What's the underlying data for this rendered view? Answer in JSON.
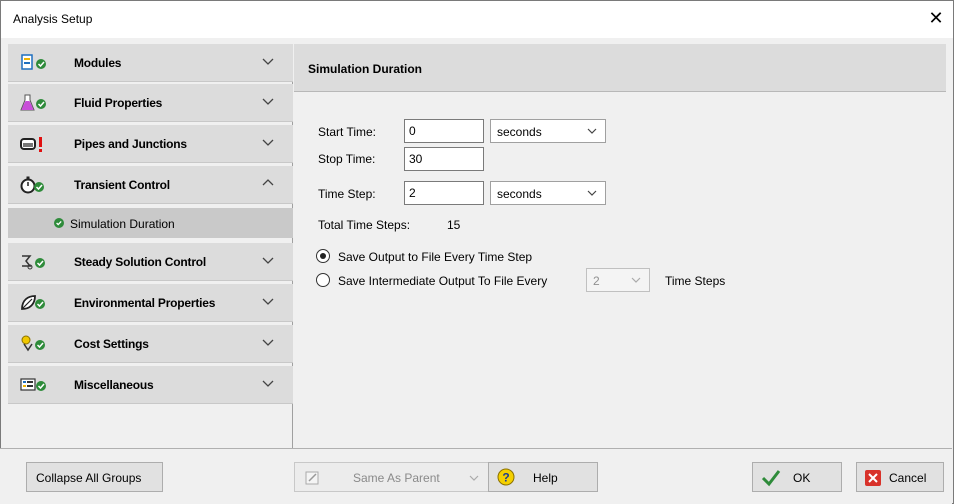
{
  "window": {
    "title": "Analysis Setup",
    "close_glyph": "✕"
  },
  "sidebar": {
    "groups": [
      {
        "label": "Modules",
        "icon": "modules-icon",
        "expanded": false
      },
      {
        "label": "Fluid Properties",
        "icon": "flask-icon",
        "expanded": false
      },
      {
        "label": "Pipes and Junctions",
        "icon": "pipe-icon",
        "expanded": false
      },
      {
        "label": "Transient Control",
        "icon": "stopwatch-icon",
        "expanded": true
      },
      {
        "label": "Steady Solution Control",
        "icon": "solver-icon",
        "expanded": false
      },
      {
        "label": "Environmental Properties",
        "icon": "leaf-icon",
        "expanded": false
      },
      {
        "label": "Cost Settings",
        "icon": "coins-icon",
        "expanded": false
      },
      {
        "label": "Miscellaneous",
        "icon": "misc-icon",
        "expanded": false
      }
    ],
    "subitems": [
      {
        "label": "Simulation Duration",
        "parent": "Transient Control",
        "selected": true
      }
    ]
  },
  "main": {
    "header": "Simulation Duration",
    "start_time": {
      "label": "Start Time:",
      "value": "0",
      "unit": "seconds"
    },
    "stop_time": {
      "label": "Stop Time:",
      "value": "30"
    },
    "time_step": {
      "label": "Time Step:",
      "value": "2",
      "unit": "seconds"
    },
    "total_steps": {
      "label": "Total Time Steps:",
      "value": "15"
    },
    "output_options": {
      "every_step_label": "Save Output to File Every Time Step",
      "intermediate_label": "Save Intermediate Output To File Every",
      "intermediate_value": "2",
      "intermediate_suffix": "Time Steps",
      "selected": "every_step"
    }
  },
  "footer": {
    "collapse_label": "Collapse All Groups",
    "same_as_parent_label": "Same As Parent",
    "help_label": "Help",
    "ok_label": "OK",
    "cancel_label": "Cancel"
  },
  "colors": {
    "status_green": "#2e8b3a",
    "warning_red": "#e01010",
    "cancel_red": "#d8322a",
    "panel_header": "#dcdcdc"
  }
}
